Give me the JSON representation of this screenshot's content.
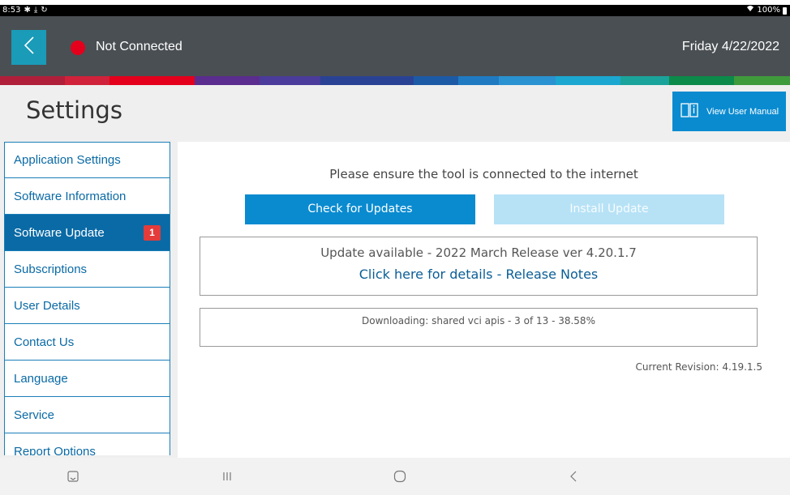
{
  "status_bar": {
    "time": "8:53",
    "icons_left": [
      "gear-icon",
      "download-icon",
      "sync-icon"
    ],
    "battery": "100%"
  },
  "header": {
    "connection_status": "Not Connected",
    "date": "Friday 4/22/2022",
    "status_color": "#e4001c"
  },
  "page": {
    "title": "Settings",
    "manual_button": "View User Manual"
  },
  "sidebar": {
    "items": [
      {
        "label": "Application Settings"
      },
      {
        "label": "Software Information"
      },
      {
        "label": "Software Update",
        "badge": "1",
        "active": true
      },
      {
        "label": "Subscriptions"
      },
      {
        "label": "User Details"
      },
      {
        "label": "Contact Us"
      },
      {
        "label": "Language"
      },
      {
        "label": "Service"
      },
      {
        "label": "Report Options"
      }
    ]
  },
  "content": {
    "notice": "Please ensure the tool is connected to the internet",
    "check_button": "Check for Updates",
    "install_button": "Install Update",
    "update_available": "Update available - 2022 March Release ver 4.20.1.7",
    "release_notes_link": "Click here for details - Release Notes",
    "download_status": "Downloading: shared vci apis - 3 of 13 - 38.58%",
    "current_revision": "Current Revision: 4.19.1.5"
  },
  "colors": {
    "header_bg": "#4a4f53",
    "accent": "#0a8bd0",
    "sidebar_active": "#0a6aa5",
    "badge": "#e43b3b"
  }
}
